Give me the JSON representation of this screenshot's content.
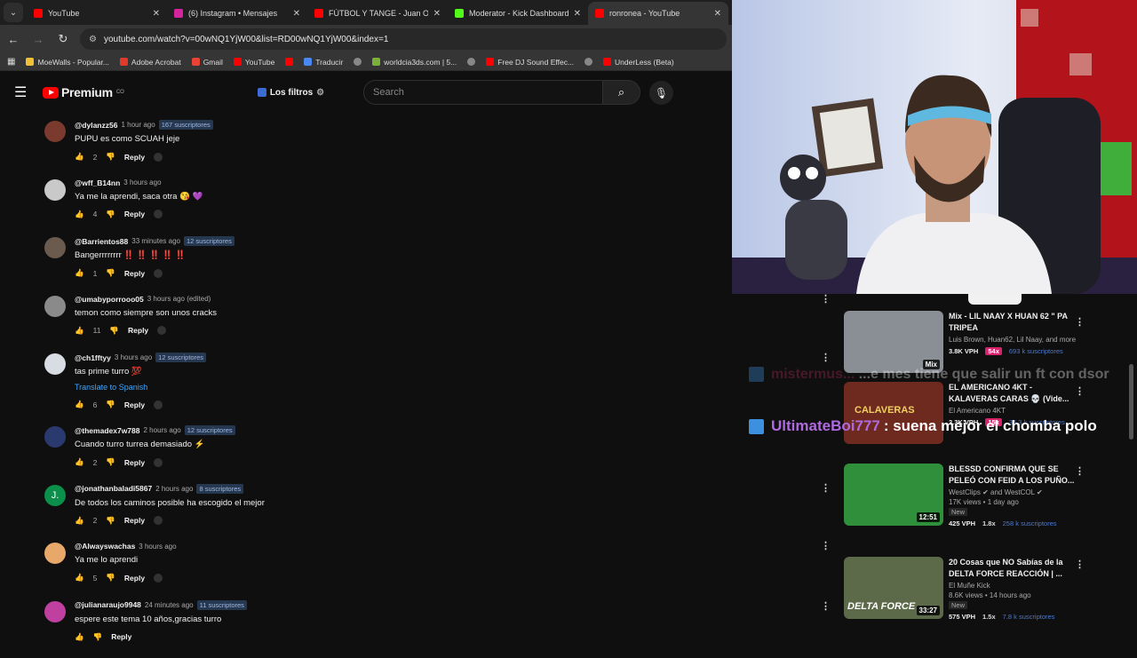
{
  "browser": {
    "tabs": [
      {
        "label": "YouTube",
        "color": "#ff0000"
      },
      {
        "label": "(6) Instagram • Mensajes",
        "color": "#d6249f"
      },
      {
        "label": "FÚTBOL Y TANGE - Juan One, T",
        "color": "#ff0000"
      },
      {
        "label": "Moderator - Kick Dashboard",
        "color": "#53fc18"
      },
      {
        "label": "ronronea - YouTube",
        "color": "#ff0000"
      }
    ],
    "url": "youtube.com/watch?v=00wNQ1YjW00&list=RD00wNQ1YjW00&index=1",
    "bookmarks": [
      {
        "label": "MoeWalls - Popular...",
        "color": "#f2c037"
      },
      {
        "label": "Adobe Acrobat",
        "color": "#e03a2b"
      },
      {
        "label": "Gmail",
        "color": "#ea4335"
      },
      {
        "label": "YouTube",
        "color": "#ff0000"
      },
      {
        "label": "",
        "color": "#ff0000"
      },
      {
        "label": "Traducir",
        "color": "#4a89f3"
      },
      {
        "label": "",
        "color": "#888888"
      },
      {
        "label": "worldcia3ds.com | 5...",
        "color": "#7bb03a"
      },
      {
        "label": "",
        "color": "#888888"
      },
      {
        "label": "Free DJ Sound Effec...",
        "color": "#ff0000"
      },
      {
        "label": "",
        "color": "#888888"
      },
      {
        "label": "UnderLess (Beta)",
        "color": "#ff0000"
      }
    ]
  },
  "youtube": {
    "logo_text": "Premium",
    "logo_sup": "CO",
    "filters_label": "Los filtros",
    "search_placeholder": "Search"
  },
  "comments": [
    {
      "handle": "@dylanzz56",
      "time": "1 hour ago",
      "subs": "167 suscriptores",
      "text": "PUPU es como SCUAH jeje",
      "likes": "2",
      "avatar": "#7a3b2e",
      "translate": ""
    },
    {
      "handle": "@wff_B14nn",
      "time": "3 hours ago",
      "subs": "",
      "text": "Ya me la aprendi, saca otra 😘 💜",
      "likes": "4",
      "avatar": "#c9c9c9",
      "translate": ""
    },
    {
      "handle": "@Barrientos88",
      "time": "33 minutes ago",
      "subs": "12 suscriptores",
      "text": "Bangerrrrrrrr ‼️ ‼️ ‼️ ‼️ ‼️",
      "likes": "1",
      "avatar": "#6b5a4e",
      "translate": ""
    },
    {
      "handle": "@umabyporrooo05",
      "time": "3 hours ago (edited)",
      "subs": "",
      "text": "temon como siempre son unos cracks",
      "likes": "11",
      "avatar": "#8a8a8a",
      "translate": ""
    },
    {
      "handle": "@ch1fftyy",
      "time": "3 hours ago",
      "subs": "12 suscriptores",
      "text": "tas prime turro 💯",
      "likes": "6",
      "avatar": "#d8dde3",
      "translate": "Translate to Spanish"
    },
    {
      "handle": "@themadex7w788",
      "time": "2 hours ago",
      "subs": "12 suscriptores",
      "text": "Cuando turro turrea demasiado ⚡",
      "likes": "2",
      "avatar": "#2a3a6e",
      "translate": ""
    },
    {
      "handle": "@jonathanbaladi5867",
      "time": "2 hours ago",
      "subs": "8 suscriptores",
      "text": "De todos los caminos posible ha escogido el mejor",
      "likes": "2",
      "avatar": "#0b8f4a",
      "translate": ""
    },
    {
      "handle": "@Alwayswachas",
      "time": "3 hours ago",
      "subs": "",
      "text": "Ya me lo aprendi",
      "likes": "5",
      "avatar": "#e8a86a",
      "translate": ""
    },
    {
      "handle": "@julianaraujo9948",
      "time": "24 minutes ago",
      "subs": "11 suscriptores",
      "text": "espere este tema 10 años,gracias turro",
      "likes": "",
      "avatar": "#c040a0",
      "translate": ""
    }
  ],
  "reply_label": "Reply",
  "sidebar": [
    {
      "title": "Mix - LIL NAAY X HUAN 62 \" PA TRIPEA",
      "channel": "Luis Brown, Huan62, Lil Naay, and more",
      "vph": "3.8K VPH",
      "mult": "54x",
      "subs": "693 k suscriptores",
      "badge": "",
      "views": "",
      "dur": "Mix",
      "thumb": "#8a8f95"
    },
    {
      "title": "EL AMERICANO 4KT - KALAVERAS CARAS 💀 (Vide...",
      "channel": "El Americano 4KT",
      "vph": "2.3K VPH",
      "mult": "15x",
      "subs": "35.3 k suscriptores",
      "badge": "",
      "views": "",
      "dur": "",
      "thumb": "#6e2a1e"
    },
    {
      "title": "BLESSD CONFIRMA QUE SE PELEÓ CON FEID A LOS PUÑO...",
      "channel": "WestClips ✔ and WestCOL ✔",
      "vph": "425 VPH",
      "mult": "1.8x",
      "subs": "258 k suscriptores",
      "badge": "New",
      "views": "17K views • 1 day ago",
      "dur": "12:51",
      "thumb": "#2f8f3a"
    },
    {
      "title": "20 Cosas que NO Sabías de la DELTA FORCE REACCIÓN | ...",
      "channel": "El Muñe Kick",
      "vph": "575 VPH",
      "mult": "1.5x",
      "subs": "7.8 k suscriptores",
      "badge": "New",
      "views": "8.6K views • 14 hours ago",
      "dur": "33:27",
      "thumb": "#5d6a4a"
    }
  ],
  "chat": [
    {
      "user": "mistermus...",
      "text": "...e mes tiene que salir un ft con dsor",
      "user_color": "#b02a5a"
    },
    {
      "user": "UltimateBoi777",
      "text": ": suena mejor el chomba polo",
      "user_color": "#b06ae0"
    }
  ],
  "thumb_text": {
    "delta": "DELTA FORCE",
    "kalaveras": "CALAVERAS"
  }
}
